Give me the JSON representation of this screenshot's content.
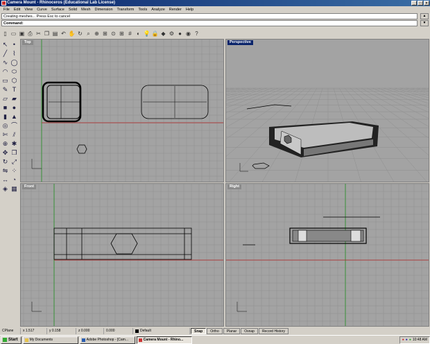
{
  "window": {
    "title": "Camera Mount - Rhinoceros (Educational Lab License)"
  },
  "menu": [
    "File",
    "Edit",
    "View",
    "Curve",
    "Surface",
    "Solid",
    "Mesh",
    "Dimension",
    "Transform",
    "Tools",
    "Analyze",
    "Render",
    "Help"
  ],
  "command": {
    "history": "Creating meshes... Press Esc to cancel",
    "prompt": "Command:"
  },
  "toolbar_icons": [
    "new-icon",
    "open-icon",
    "save-icon",
    "print-icon",
    "cut-icon",
    "copy-icon",
    "paste-icon",
    "undo-icon",
    "pan-icon",
    "rotate-view-icon",
    "zoom-icon",
    "zoom-window-icon",
    "zoom-extents-icon",
    "zoom-selected-icon",
    "four-viewports-icon",
    "grid-icon",
    "hide-icon",
    "show-icon",
    "lock-icon",
    "layer-icon",
    "properties-icon",
    "render-icon",
    "material-icon",
    "help-icon"
  ],
  "left_tools": [
    "select-icon",
    "point-icon",
    "line-icon",
    "polyline-icon",
    "curve-icon",
    "circle-icon",
    "arc-icon",
    "ellipse-icon",
    "rectangle-icon",
    "polygon-icon",
    "freeform-icon",
    "text-icon",
    "surface-icon",
    "extrude-icon",
    "box-icon",
    "sphere-icon",
    "cylinder-icon",
    "cone-icon",
    "torus-icon",
    "fillet-icon",
    "trim-icon",
    "split-icon",
    "join-icon",
    "explode-icon",
    "move-icon",
    "copy-transform-icon",
    "rotate-icon",
    "scale-icon",
    "mirror-icon",
    "array-icon",
    "dimension-icon",
    "analyze-icon",
    "render-tool-icon",
    "mesh-icon"
  ],
  "viewports": {
    "top": "Top",
    "perspective": "Perspective",
    "front": "Front",
    "right": "Right"
  },
  "status": {
    "cplane": "CPlane",
    "x": "x 1.517",
    "y": "y 0.158",
    "z": "z 0.000",
    "w": "0.000",
    "layer": "Default",
    "layer_color": "#000000"
  },
  "status_buttons": [
    {
      "label": "Snap",
      "on": true
    },
    {
      "label": "Ortho",
      "on": false
    },
    {
      "label": "Planar",
      "on": false
    },
    {
      "label": "Osnap",
      "on": false
    },
    {
      "label": "Record History",
      "on": false
    }
  ],
  "taskbar": {
    "start": "Start",
    "buttons": [
      "My Documents",
      "Adobe Photoshop - [Cam...",
      "Camera Mount - Rhino..."
    ],
    "active_index": 2,
    "clock": "10:48 AM"
  },
  "colors": {
    "title_bar": "#0a246a",
    "viewport_bg": "#a3a3a3",
    "grid_x_axis": "#b02020",
    "grid_y_axis": "#209020"
  }
}
